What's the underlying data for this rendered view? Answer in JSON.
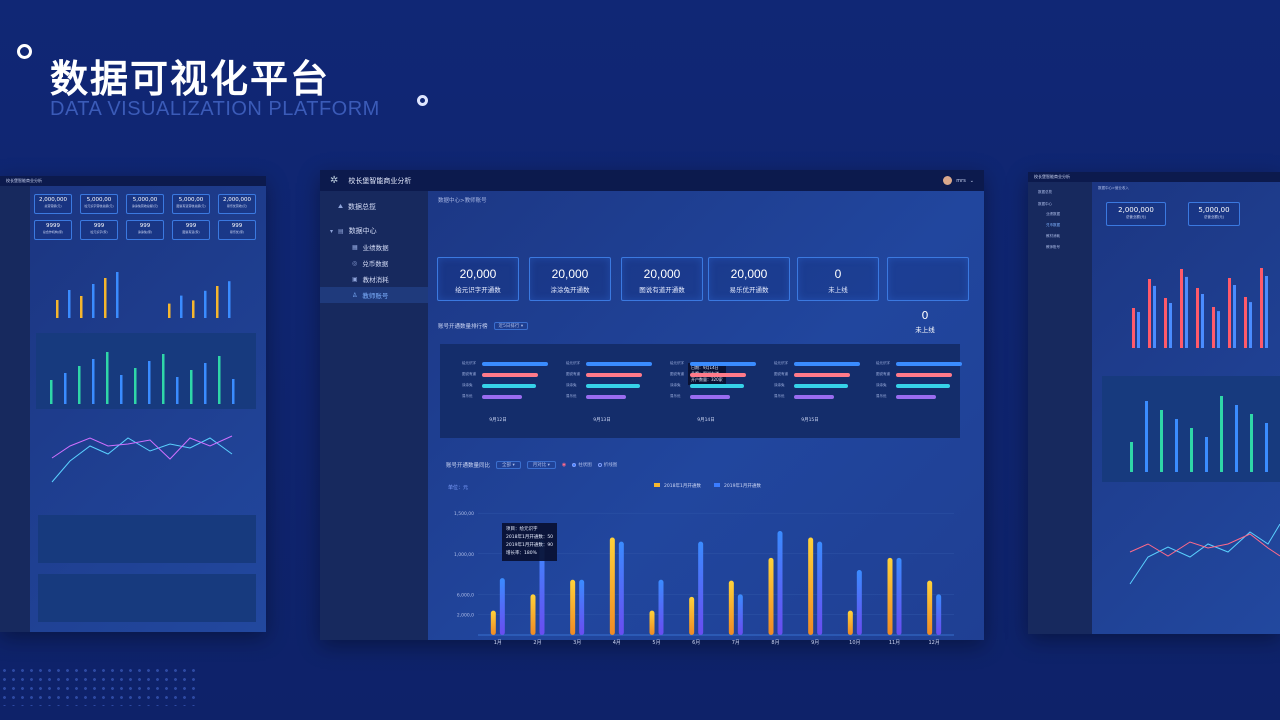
{
  "hero": {
    "title": "数据可视化平台",
    "subtitle": "DATA VISUALIZATION PLATFORM"
  },
  "main": {
    "app_title": "校长堡智能商业分析",
    "user_name": "mrs",
    "breadcrumb": "数据中心>教师账号",
    "sidebar": {
      "overview": "数据总揽",
      "data_center": "数据中心",
      "items": [
        "业绩数据",
        "兑币数据",
        "教材消耗",
        "教师账号"
      ]
    },
    "stats": [
      {
        "value": "20,000",
        "label": "绘元识字开通数"
      },
      {
        "value": "20,000",
        "label": "涂涂兔开通数"
      },
      {
        "value": "20,000",
        "label": "图说有道开通数"
      },
      {
        "value": "20,000",
        "label": "易乐优开通数"
      },
      {
        "value": "0",
        "label": "未上线"
      },
      {
        "value": "",
        "label": ""
      }
    ],
    "extra_stat": {
      "value": "0",
      "label": "未上线"
    },
    "rank": {
      "title": "账号开通数量排行榜",
      "filter": "近5日排行",
      "row_labels": [
        "绘元识字",
        "图说有道",
        "涂涂兔",
        "易乐优"
      ],
      "dates": [
        "9月12日",
        "9月13日",
        "9月14日",
        "9月15日",
        ""
      ],
      "tooltip": [
        "日期：9月14日",
        "品牌：图说有道",
        "开户数量：320家"
      ]
    },
    "chart": {
      "title": "账号开通数量同比",
      "select1": "全部",
      "select2": "月对比",
      "radio1": "柱状图",
      "radio2": "折线图",
      "tooltip": [
        "项目：绘元识字",
        "2018年1月开通数：50",
        "2019年1月开通数：90",
        "增长率：180%"
      ]
    },
    "chart_data": {
      "type": "bar",
      "title": "",
      "ylabel": "单位：元",
      "xlabel": "",
      "categories": [
        "1月",
        "2月",
        "3月",
        "4月",
        "5月",
        "6月",
        "7月",
        "8月",
        "9月",
        "10月",
        "11月",
        "12月"
      ],
      "yticks": [
        "2,000,0",
        "6,000,0",
        "1,000,00",
        "1,500,00"
      ],
      "ylim": [
        0,
        1650
      ],
      "series": [
        {
          "name": "2018年1月开通数",
          "color": "#f5b62e",
          "values": [
            300,
            500,
            680,
            1200,
            300,
            470,
            670,
            950,
            1200,
            300,
            950,
            670
          ]
        },
        {
          "name": "2019年1月开通数",
          "color": "#3a7cff",
          "values": [
            700,
            1170,
            680,
            1150,
            680,
            1150,
            500,
            1280,
            1150,
            800,
            950,
            500
          ]
        }
      ],
      "grid": true,
      "legend": "top"
    }
  },
  "left_preview": {
    "app_title": "校长堡智能商业分析",
    "cards": [
      {
        "value": "2,000,000",
        "label": "总营营额(元)"
      },
      {
        "value": "5,000,00",
        "label": "绘元识字营收总额(元)"
      },
      {
        "value": "5,000,00",
        "label": "涂涂兔营收总额(元)"
      },
      {
        "value": "5,000,00",
        "label": "图说有道营收总额(元)"
      },
      {
        "value": "2,000,000",
        "label": "易乐优营收(元)"
      },
      {
        "value": "9999",
        "label": "总合作机构(家)"
      },
      {
        "value": "999",
        "label": "绘元识字(家)"
      },
      {
        "value": "999",
        "label": "涂涂兔(家)"
      },
      {
        "value": "999",
        "label": "图说有道(家)"
      },
      {
        "value": "999",
        "label": "易乐优(家)"
      }
    ]
  },
  "right_preview": {
    "app_title": "校长堡智能商业分析",
    "breadcrumb": "数据中心>营业收入",
    "sidebar": [
      "数据总揽",
      "数据中心",
      "业绩数据",
      "兑币数据",
      "教材消耗",
      "教师账号"
    ],
    "cards": [
      {
        "value": "2,000,000",
        "label": "总营业额(元)"
      },
      {
        "value": "5,000,00",
        "label": "总营业额(元)"
      }
    ]
  },
  "colors": {
    "background": "#0f2470",
    "panel": "#1b347f",
    "accent": "#3a7cff",
    "gold": "#f5b62e"
  }
}
